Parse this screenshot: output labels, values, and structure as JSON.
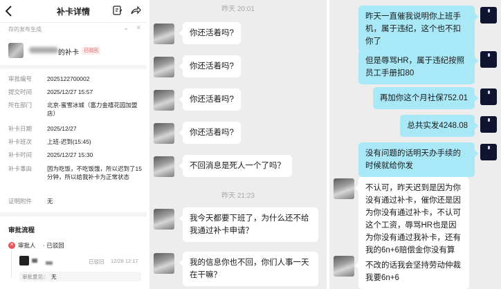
{
  "colors": {
    "chat_bg": "#ededed",
    "bubble_incoming": "#ffffff",
    "bubble_outgoing": "#a9e9f7",
    "reject_red": "#e95353",
    "avatar_dark": "#0f1430"
  },
  "detail": {
    "header": {
      "back_icon": "chevron-left-icon",
      "title": "补卡详情",
      "action_icons": [
        "edit-note-icon",
        "share-arrow-icon"
      ]
    },
    "dropdown": {
      "placeholder": "存的发布生成",
      "arrow": "⌄",
      "close": "✕"
    },
    "applicant": {
      "name_suffix": "的补卡",
      "status": "已驳回"
    },
    "fields": [
      {
        "label": "审批编号",
        "value": "2025122700002"
      },
      {
        "label": "提交时间",
        "value": "2025/12/27 15:57"
      },
      {
        "label": "所在部门",
        "value": "北京-蜜雪冰城（富力金禧花园加盟店）"
      },
      {
        "label": "补卡日期",
        "value": "2025/12/27"
      },
      {
        "label": "补卡班次",
        "value": "上班-迟到(15:45)"
      },
      {
        "label": "补卡时间",
        "value": "2025/12/27 15:30"
      },
      {
        "label": "补卡事由",
        "value": "因为吃饭，不吃饭饿，所以迟到了15分钟，所以给我补卡为正常状态"
      },
      {
        "label": "证明附件",
        "value": "无"
      }
    ],
    "flow": {
      "title": "审批流程",
      "approver": "审批人",
      "state": "· 已驳回",
      "record_status": "已驳回",
      "record_time": "12/28 12:17",
      "opinion_label": "审批意见：",
      "opinion_value": "无"
    }
  },
  "chat_left": {
    "timestamps": [
      {
        "id": "ts1",
        "text": "昨天 20:01"
      },
      {
        "id": "ts2",
        "text": "昨天 21:23"
      }
    ],
    "messages": [
      {
        "id": "m1",
        "text": "你还活着吗?"
      },
      {
        "id": "m2",
        "text": "你还活着吗?"
      },
      {
        "id": "m3",
        "text": "你还活着吗?"
      },
      {
        "id": "m4",
        "text": "你还活着吗?"
      },
      {
        "id": "m5",
        "text": "不回消息是死人一个了吗？"
      },
      {
        "id": "m6",
        "text": "我今天都要下班了，为什么还不给我通过补卡申请？"
      },
      {
        "id": "m7",
        "text": "我的信息你也不回，你们人事一天在干嘛？"
      }
    ]
  },
  "chat_right": {
    "messages": [
      {
        "id": "r1",
        "dir": "out",
        "text": "昨天一直催我说明你上班手机，属于违纪，这个也不扣你了"
      },
      {
        "id": "r2",
        "dir": "out",
        "text": "但是辱骂HR，属于违纪按照员工手册扣80"
      },
      {
        "id": "r3",
        "dir": "out",
        "text": "再加你这个月社保752.01"
      },
      {
        "id": "r4",
        "dir": "out",
        "text": "总共实发4248.08"
      },
      {
        "id": "r5",
        "dir": "out",
        "text": "没有问题的话明天办手续的时候就给你发"
      },
      {
        "id": "r6",
        "dir": "in",
        "text": "不认可，昨天迟到是因为你没有通过补卡，催你还是因为你没有通过补卡，不认可这个工资，辱骂HR也是因为你没有通过我补卡，还有我的6n+6赔偿金你没有算"
      },
      {
        "id": "r7",
        "dir": "in",
        "text": "不改的话我会坚持劳动仲裁我要6n+6"
      }
    ]
  }
}
